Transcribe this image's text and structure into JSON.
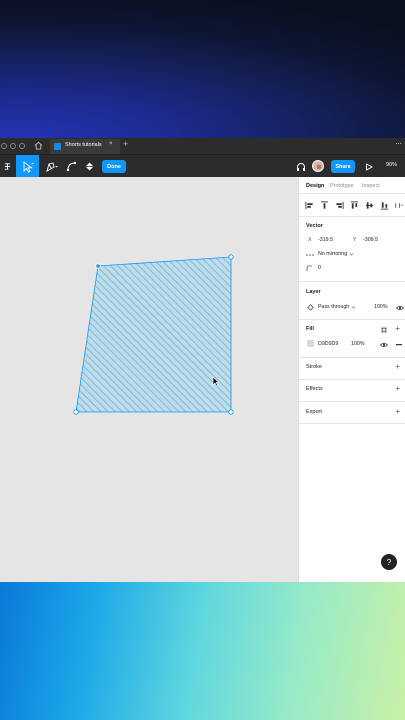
{
  "tabbar": {
    "tab_label": "Shorts tutorials",
    "tab_close": "×",
    "new_tab": "+",
    "more": "···"
  },
  "toolbar": {
    "done_label": "Done",
    "share_label": "Share",
    "zoom": "90%"
  },
  "panel": {
    "tabs": [
      "Design",
      "Prototype",
      "Inspect"
    ],
    "vector": {
      "title": "Vector",
      "x_label": "X",
      "x_value": "-319.5",
      "y_label": "Y",
      "y_value": "-309.5",
      "mirroring": "No mirroring",
      "corner_radius": "0"
    },
    "layer": {
      "title": "Layer",
      "blend": "Pass through",
      "opacity": "100%"
    },
    "fill": {
      "title": "Fill",
      "hex": "D9D9D9",
      "opacity": "100%",
      "swatch_color": "#d9d9d9"
    },
    "stroke": {
      "title": "Stroke"
    },
    "effects": {
      "title": "Effects"
    },
    "export": {
      "title": "Export"
    },
    "help": "?"
  },
  "colors": {
    "accent": "#0d99ff",
    "shape_fill": "#bfdcea",
    "shape_hatch": "#6fb3d6",
    "chrome": "#2c2c2c"
  }
}
